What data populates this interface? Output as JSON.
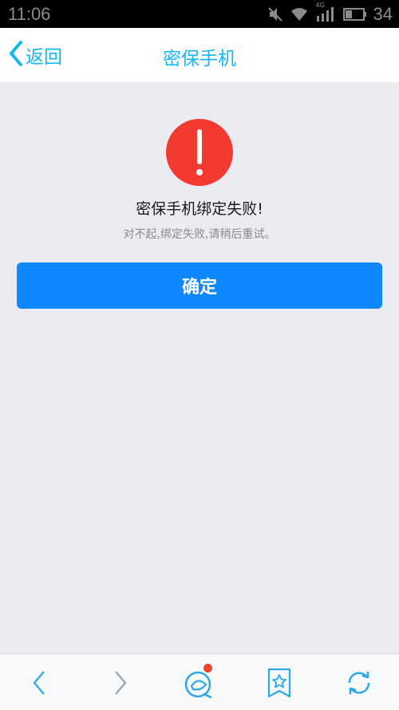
{
  "status_bar": {
    "time": "11:06",
    "network_label": "4G",
    "battery_level": "34",
    "icons": [
      "mute-icon",
      "wifi-icon",
      "signal-icon",
      "battery-icon"
    ]
  },
  "nav": {
    "back_label": "返回",
    "title": "密保手机",
    "accent_color": "#12b7f5"
  },
  "result": {
    "icon": "error-icon",
    "title": "密保手机绑定失败!",
    "message": "对不起,绑定失败,请稍后重试。",
    "confirm_label": "确定",
    "error_color": "#f23a30",
    "button_color": "#0f87ff"
  },
  "toolbar": {
    "items": [
      {
        "icon": "back-arrow-icon"
      },
      {
        "icon": "forward-arrow-icon"
      },
      {
        "icon": "qzone-icon",
        "has_notification": true
      },
      {
        "icon": "bookmark-icon"
      },
      {
        "icon": "refresh-icon"
      }
    ]
  }
}
